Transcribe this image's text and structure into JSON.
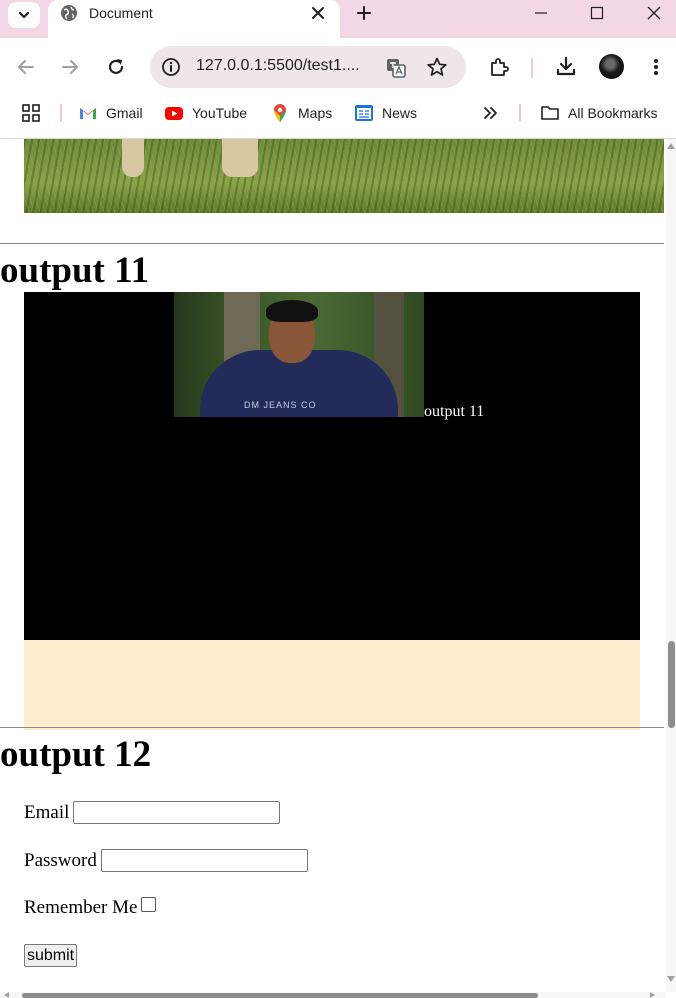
{
  "browser": {
    "tab_title": "Document",
    "url": "127.0.0.1:5500/test1....",
    "bookmarks": [
      {
        "label": "Gmail",
        "icon": "gmail-icon"
      },
      {
        "label": "YouTube",
        "icon": "youtube-icon"
      },
      {
        "label": "Maps",
        "icon": "maps-icon"
      },
      {
        "label": "News",
        "icon": "news-icon"
      }
    ],
    "all_bookmarks_label": "All Bookmarks",
    "colors": {
      "tabstrip": "#f4d7e6",
      "omnibox": "#efe6ea"
    }
  },
  "page": {
    "output11": {
      "heading": "output 11",
      "video_caption": "output 11",
      "thumbnail_print": "DM JEANS CO",
      "colors": {
        "video_bg": "#000000",
        "box_bg": "#ffebcd"
      }
    },
    "output12": {
      "heading": "output 12",
      "email_label": "Email",
      "email_value": "",
      "password_label": "Password",
      "password_value": "",
      "remember_label": "Remember Me",
      "remember_checked": false,
      "submit_label": "submit"
    }
  }
}
